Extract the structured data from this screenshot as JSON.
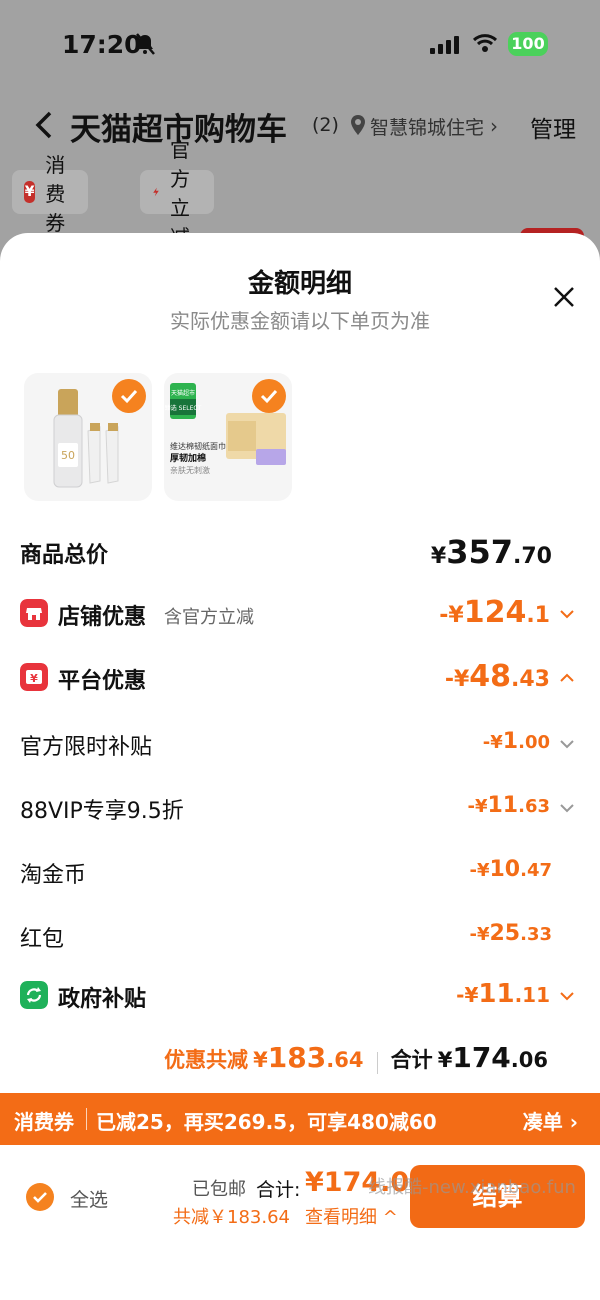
{
  "status": {
    "time": "17:20",
    "battery": "100"
  },
  "nav": {
    "title": "天猫超市购物车",
    "count": "(2)",
    "address": "智慧锦城住宅",
    "manage": "管理"
  },
  "chips": [
    {
      "icon": "¥",
      "label": "消费券"
    },
    {
      "label": "官方立减"
    }
  ],
  "sheet": {
    "title": "金额明细",
    "subtitle": "实际优惠金额请以下单页为准",
    "products": [
      {
        "name": "sunscreen-product",
        "label": "50"
      },
      {
        "name": "tissue-product",
        "brand": "天猫超市",
        "tag": "臻选 SELECT",
        "line1": "维达棉韧纸面巾",
        "line2": "厚韧加棉",
        "line3": "亲肤无刺激"
      }
    ],
    "rows": {
      "goods_total": {
        "label": "商品总价",
        "yen": "¥",
        "int": "357",
        "dec": ".70"
      },
      "store_discount": {
        "label": "店铺优惠",
        "note": "含官方立减",
        "prefix": "-¥",
        "int": "124",
        "dec": ".1"
      },
      "platform_discount": {
        "label": "平台优惠",
        "prefix": "-¥",
        "int": "48",
        "dec": ".43"
      },
      "official_subsidy": {
        "label": "官方限时补贴",
        "prefix": "-¥",
        "int": "1",
        "dec": ".00"
      },
      "vip": {
        "label": "88VIP专享9.5折",
        "prefix": "-¥",
        "int": "11",
        "dec": ".63"
      },
      "coins": {
        "label": "淘金币",
        "prefix": "-¥",
        "int": "10",
        "dec": ".47"
      },
      "redpacket": {
        "label": "红包",
        "prefix": "-¥",
        "int": "25",
        "dec": ".33"
      },
      "gov_subsidy": {
        "label": "政府补贴",
        "prefix": "-¥",
        "int": "11",
        "dec": ".11"
      }
    },
    "summary": {
      "saved_label": "优惠共减",
      "saved_yen": "¥",
      "saved_int": "183",
      "saved_dec": ".64",
      "total_label": "合计",
      "total_yen": "¥",
      "total_int": "174",
      "total_dec": ".06"
    }
  },
  "strip": {
    "label": "消费券",
    "text": "已减25，再买269.5，可享480减60",
    "link": "凑单 ›"
  },
  "bottom": {
    "select_all": "全选",
    "ship_free": "已包邮",
    "total_label": "合计:",
    "total_value": "¥174.06",
    "saved": "共减￥183.64",
    "detail": "查看明细 ^",
    "checkout": "结算",
    "watermark": "线报酷-new.xianbao.fun"
  },
  "colors": {
    "accent": "#f36c16",
    "icon_red": "#e8343c",
    "icon_green": "#1fb15a"
  }
}
